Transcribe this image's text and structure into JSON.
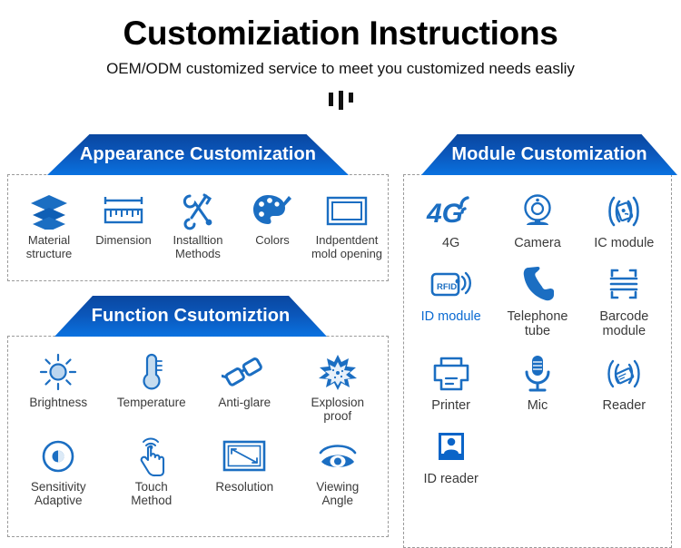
{
  "header": {
    "title": "Customiziation Instructions",
    "subtitle": "OEM/ODM customized service to meet you customized needs easliy"
  },
  "colors": {
    "brand_blue": "#0a6ad2",
    "banner_top": "#0a47a0",
    "banner_bottom": "#0a72e0",
    "label_gray": "#3a3a3a",
    "dashed_border": "#9a9a9a"
  },
  "panels": {
    "appearance": {
      "title": "Appearance Customization",
      "items": [
        {
          "label": "Material\nstructure",
          "icon": "layers-icon"
        },
        {
          "label": "Dimension",
          "icon": "ruler-icon"
        },
        {
          "label": "Installtion\nMethods",
          "icon": "tools-icon"
        },
        {
          "label": "Colors",
          "icon": "palette-icon"
        },
        {
          "label": "Indpentdent\nmold opening",
          "icon": "frame-icon"
        }
      ]
    },
    "function": {
      "title": "Function Csutomiztion",
      "items": [
        {
          "label": "Brightness",
          "icon": "sun-icon"
        },
        {
          "label": "Temperature",
          "icon": "thermometer-icon"
        },
        {
          "label": "Anti-glare",
          "icon": "sunglasses-icon"
        },
        {
          "label": "Explosion\nproof",
          "icon": "explosion-icon"
        },
        {
          "label": "Sensitivity\nAdaptive",
          "icon": "sensitivity-icon"
        },
        {
          "label": "Touch\nMethod",
          "icon": "touch-hand-icon"
        },
        {
          "label": "Resolution",
          "icon": "resolution-icon"
        },
        {
          "label": "Viewing\nAngle",
          "icon": "eye-icon"
        }
      ]
    },
    "module": {
      "title": "Module Customization",
      "items": [
        {
          "label": "4G",
          "icon": "4g-signal-icon",
          "accent": false
        },
        {
          "label": "Camera",
          "icon": "webcam-icon",
          "accent": false
        },
        {
          "label": "IC module",
          "icon": "ic-card-wave-icon",
          "accent": false
        },
        {
          "label": "ID module",
          "icon": "rfid-card-icon",
          "accent": true
        },
        {
          "label": "Telephone\ntube",
          "icon": "phone-handset-icon",
          "accent": false
        },
        {
          "label": "Barcode\nmodule",
          "icon": "barcode-scanner-icon",
          "accent": false
        },
        {
          "label": "Printer",
          "icon": "printer-icon",
          "accent": false
        },
        {
          "label": "Mic",
          "icon": "microphone-icon",
          "accent": false
        },
        {
          "label": "Reader",
          "icon": "card-reader-wave-icon",
          "accent": false
        },
        {
          "label": "ID reader",
          "icon": "id-person-card-icon",
          "accent": false
        }
      ]
    }
  }
}
